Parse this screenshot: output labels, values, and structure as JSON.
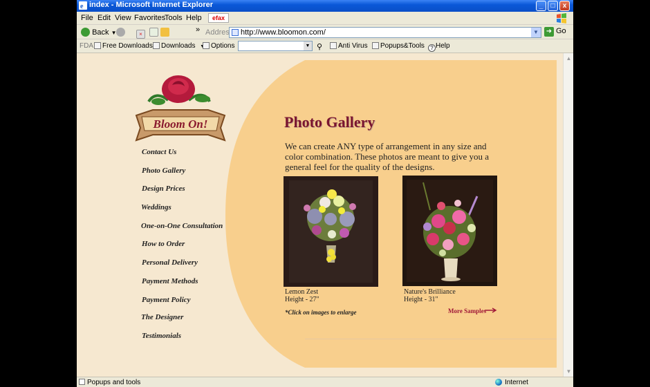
{
  "window": {
    "title": "index - Microsoft Internet Explorer",
    "buttons": {
      "minimize": "_",
      "maximize": "□",
      "close": "x"
    }
  },
  "menubar": {
    "items": [
      "File",
      "Edit",
      "View",
      "Favorites",
      "Tools",
      "Help"
    ],
    "efax_label": "efax"
  },
  "addressbar": {
    "back_label": "Back",
    "address_label": "Address",
    "url": "http://www.bloomon.com/",
    "go_label": "Go",
    "chevron": "»"
  },
  "toolbar": {
    "fda_label": "FDA",
    "free_downloads": "Free Downloads",
    "downloads": "Downloads",
    "options": "Options",
    "search_value": "",
    "antivirus": "Anti Virus",
    "popups_tools": "Popups&Tools",
    "help": "Help"
  },
  "page": {
    "logo_text": "Bloom On!",
    "nav": [
      "Contact Us",
      "Photo Gallery",
      "Design Prices",
      "Weddings",
      "One-on-One Consultation",
      "How to Order",
      "Personal Delivery",
      "Payment Methods",
      "Payment Policy",
      "The Designer",
      "Testimonials"
    ],
    "title": "Photo Gallery",
    "intro": "We can create ANY type of arrangement in any size and color combination. These photos are meant to give you a general feel for the quality of the designs.",
    "photos": [
      {
        "name": "Lemon Zest",
        "height": "Height - 27\""
      },
      {
        "name": "Nature's Brilliance",
        "height": "Height - 31\""
      }
    ],
    "click_note": "*Click on images to enlarge",
    "more_samples": "More Samples"
  },
  "statusbar": {
    "left": "Popups and tools",
    "right": "Internet"
  },
  "colors": {
    "page_background": "#f6e8d0",
    "panel": "#f8cf8d",
    "title": "#7a1530",
    "link_accent": "#a01838"
  }
}
